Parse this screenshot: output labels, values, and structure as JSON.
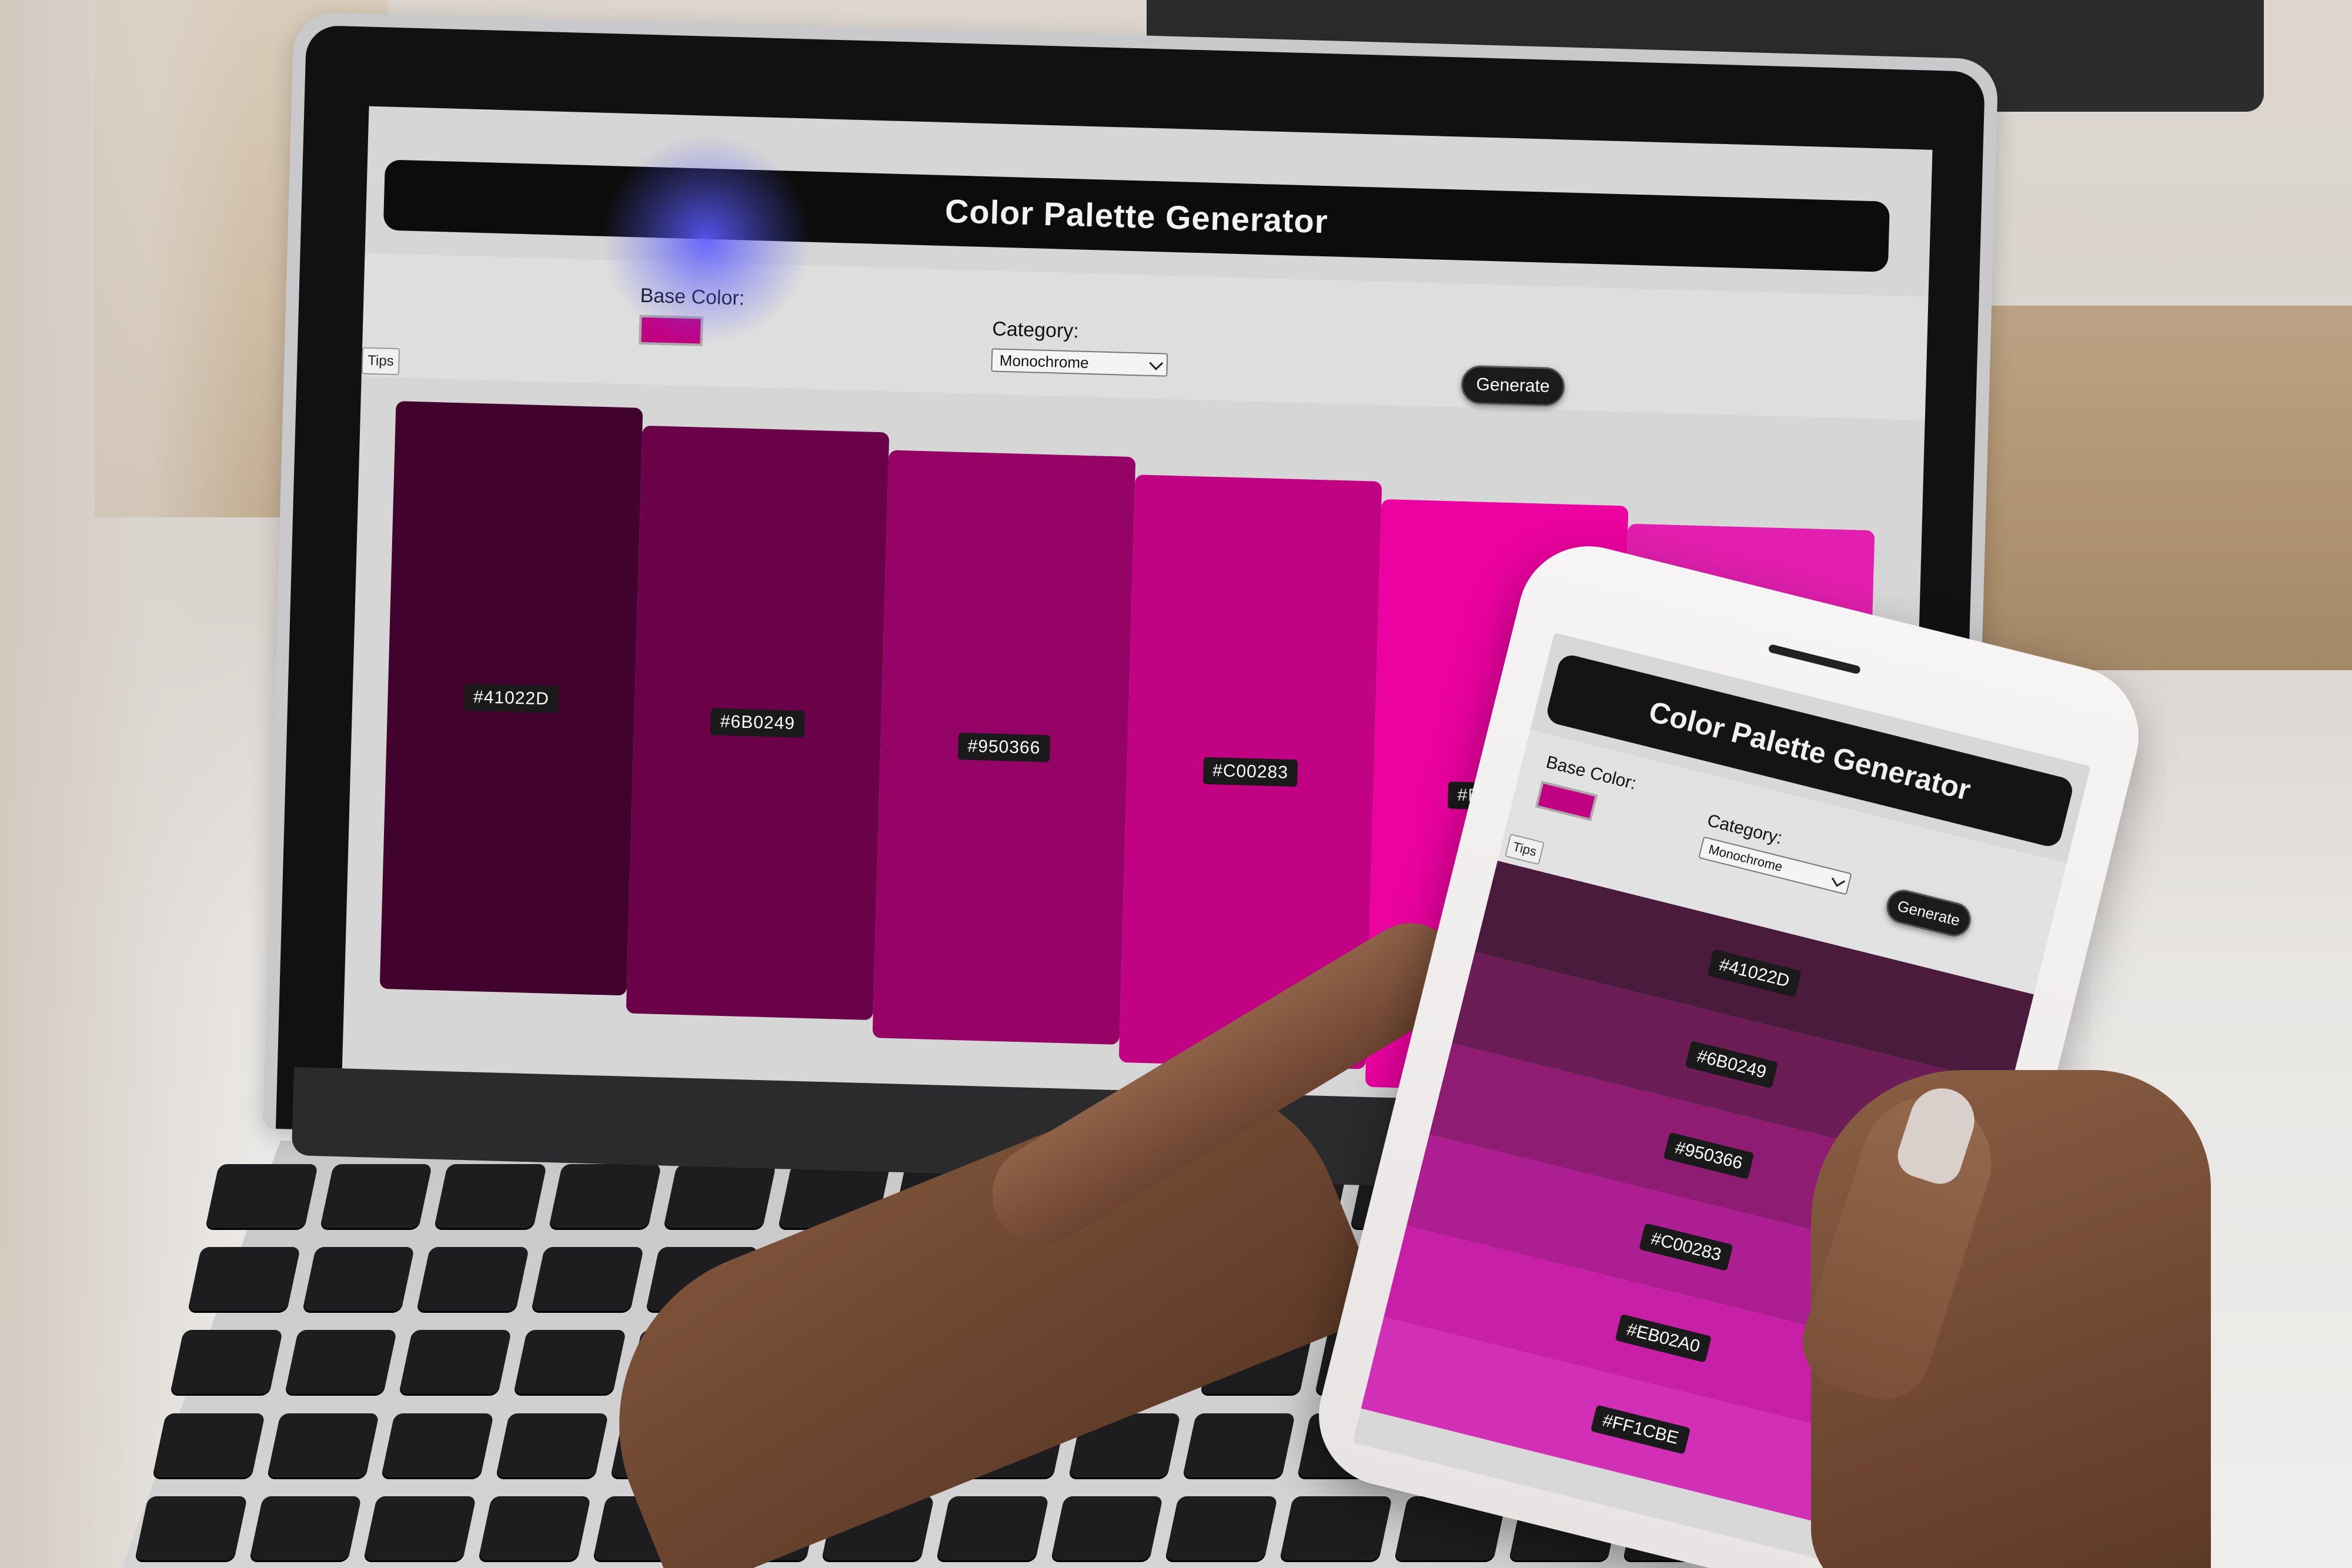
{
  "app": {
    "title": "Color Palette Generator",
    "base_color_label": "Base Color:",
    "base_color_value": "#C00283",
    "category_label": "Category:",
    "category_selected": "Monochrome",
    "generate_label": "Generate",
    "tips_label": "Tips"
  },
  "palette": [
    {
      "hex": "#41022D"
    },
    {
      "hex": "#6B0249"
    },
    {
      "hex": "#950366"
    },
    {
      "hex": "#C00283"
    },
    {
      "hex": "#EB02A0"
    },
    {
      "hex": "#EB02A0",
      "render_color": "#e21fae",
      "label_hidden": true
    }
  ],
  "phone_palette": [
    {
      "hex": "#41022D",
      "render_color": "#4a1b3c"
    },
    {
      "hex": "#6B0249",
      "render_color": "#6c1d55"
    },
    {
      "hex": "#950366",
      "render_color": "#8e1c72"
    },
    {
      "hex": "#C00283",
      "render_color": "#ad1e92"
    },
    {
      "hex": "#EB02A0",
      "render_color": "#c81fa8"
    },
    {
      "hex": "#FF1CBE",
      "render_color": "#d12fb5"
    }
  ]
}
